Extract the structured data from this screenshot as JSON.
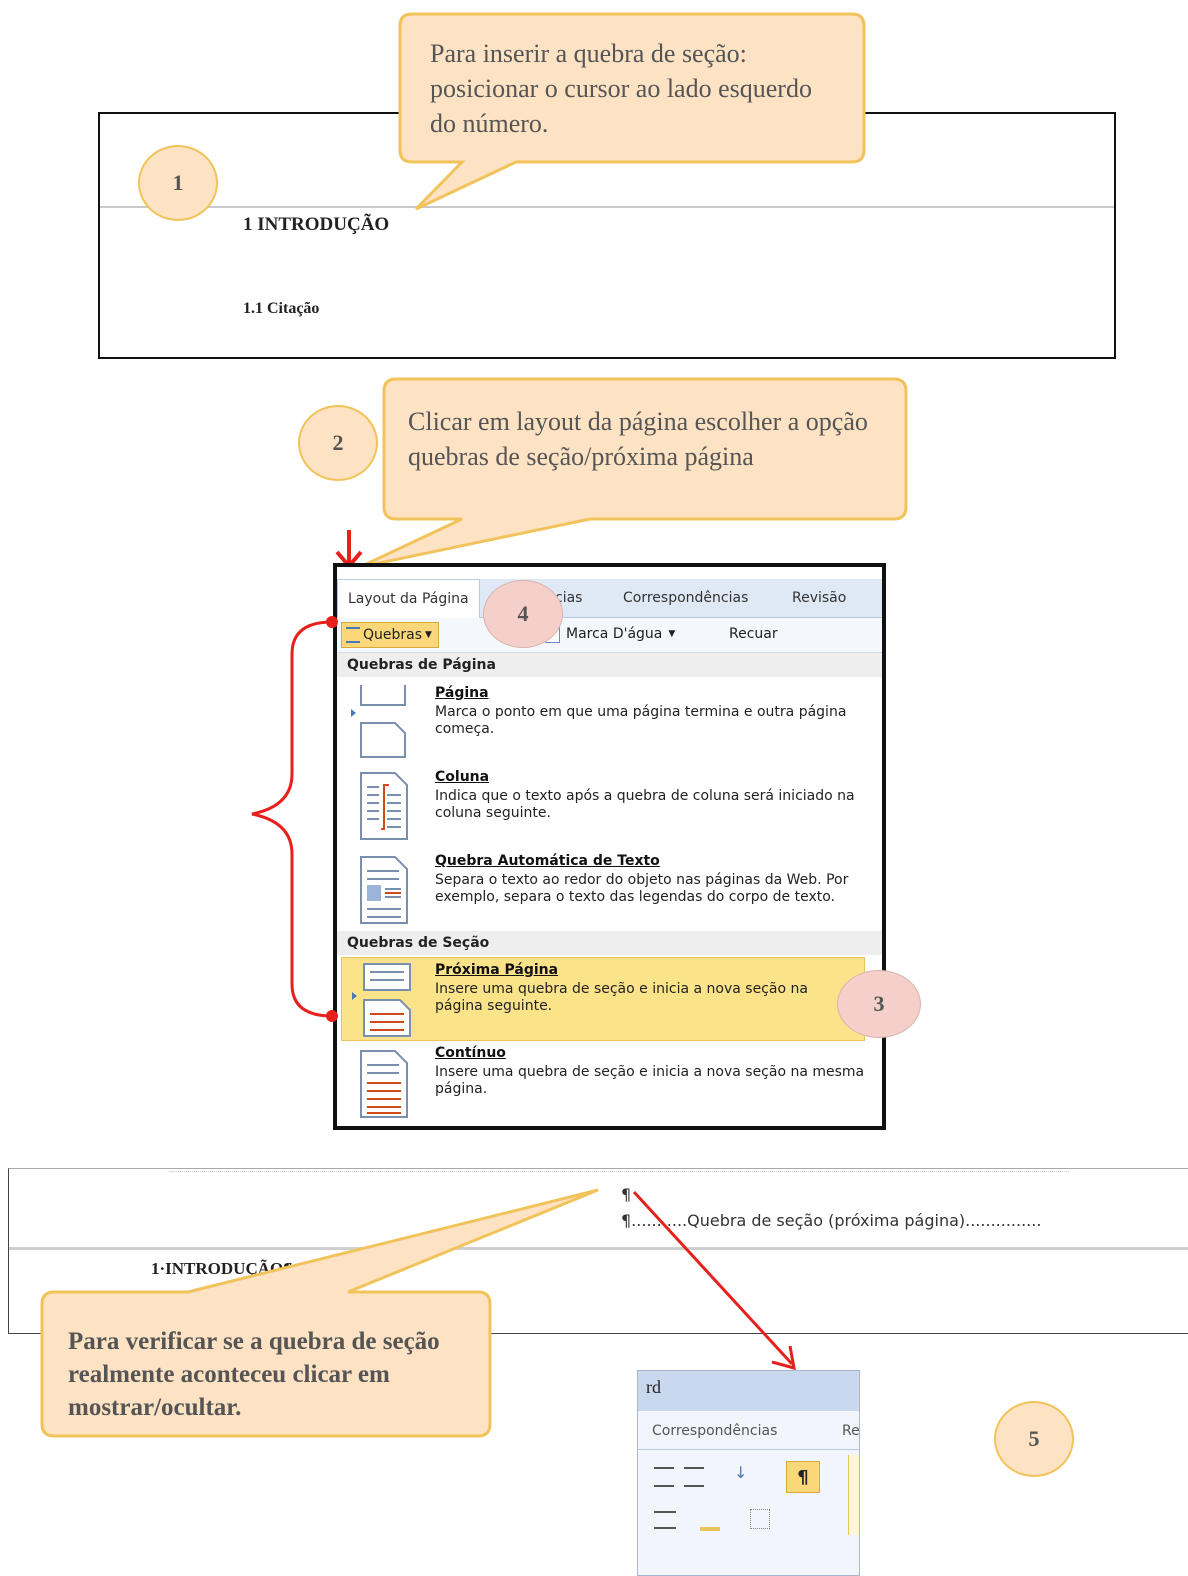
{
  "step1": {
    "number": "1",
    "callout": "Para inserir a quebra de seção: posicionar o cursor ao lado esquerdo do número.",
    "heading_intro": "1 INTRODUÇÃO",
    "heading_sub": "1.1 Citação"
  },
  "step2": {
    "number": "2",
    "callout": "Clicar em layout da página escolher a opção quebras de seção/próxima página"
  },
  "ribbon": {
    "tabs": [
      "Layout da Página",
      "cias",
      "Correspondências",
      "Revisão"
    ],
    "breaks_button": "Quebras",
    "watermark_button": "Marca D'água",
    "indent_label": "Recuar",
    "step4_number": "4",
    "page_breaks_header": "Quebras de Página",
    "section_breaks_header": "Quebras de Seção",
    "items": [
      {
        "title": "Página",
        "desc": "Marca o ponto em que uma página termina e outra página começa."
      },
      {
        "title": "Coluna",
        "desc": "Indica que o texto após a quebra de coluna será iniciado na coluna seguinte."
      },
      {
        "title": "Quebra Automática de Texto",
        "desc": "Separa o texto ao redor do objeto nas páginas da Web. Por exemplo, separa o texto das legendas do corpo de texto."
      },
      {
        "title": "Próxima Página",
        "desc": "Insere uma quebra de seção e inicia a nova seção na página seguinte."
      },
      {
        "title": "Contínuo",
        "desc": "Insere uma quebra de seção e inicia a nova seção na mesma página."
      }
    ],
    "step3_number": "3"
  },
  "step5": {
    "pilcrow": "¶",
    "section_break_text": "¶...........Quebra de seção (próxima página)...............",
    "heading_intro": "1·INTRODUÇÃO¶",
    "pilcrow2": "¶",
    "callout": "Para verificar se a quebra de seção realmente aconteceu clicar em mostrar/ocultar.",
    "number": "5",
    "mini_title": "rd",
    "mini_tab": "Correspondências",
    "mini_tab2": "Re",
    "pilcrow_button": "¶"
  },
  "colors": {
    "callout_fill": "#fde2c4",
    "callout_border": "#f2c35a",
    "arrow_red": "#e8201c",
    "highlight": "#fbe38a"
  }
}
